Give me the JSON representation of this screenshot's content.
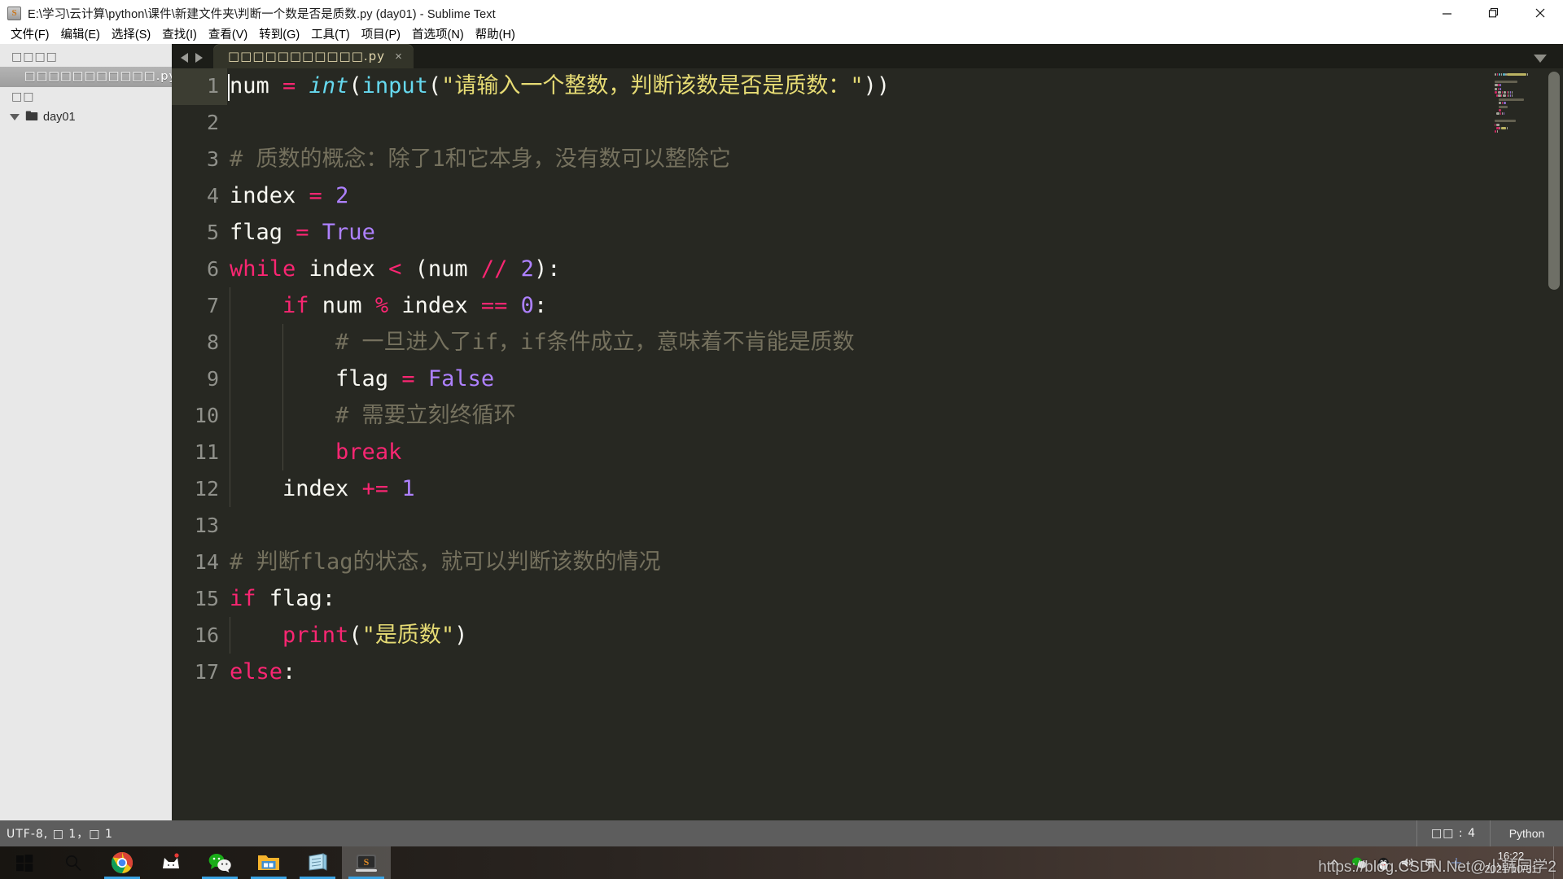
{
  "window": {
    "title": "E:\\学习\\云计算\\python\\课件\\新建文件夹\\判断一个数是否是质数.py (day01) - Sublime Text",
    "app_icon": "S",
    "minimize_icon": "minimize-icon",
    "restore_icon": "restore-icon",
    "close_icon": "close-icon"
  },
  "menubar": {
    "items": [
      {
        "label": "文件(F)"
      },
      {
        "label": "编辑(E)"
      },
      {
        "label": "选择(S)"
      },
      {
        "label": "查找(I)"
      },
      {
        "label": "查看(V)"
      },
      {
        "label": "转到(G)"
      },
      {
        "label": "工具(T)"
      },
      {
        "label": "项目(P)"
      },
      {
        "label": "首选项(N)"
      },
      {
        "label": "帮助(H)"
      }
    ]
  },
  "sidebar": {
    "open_files_header": "□□□□",
    "open_file": "□□□□□□□□□□□.py",
    "folders_header": "□□",
    "folder_name": "day01"
  },
  "tabbar": {
    "nav_prev_icon": "arrow-left-icon",
    "nav_next_icon": "arrow-right-icon",
    "tab_label": "□□□□□□□□□□□.py",
    "tab_close_icon": "×",
    "dropdown_icon": "chevron-down-icon"
  },
  "editor": {
    "language": "Python",
    "line_numbers": [
      1,
      2,
      3,
      4,
      5,
      6,
      7,
      8,
      9,
      10,
      11,
      12,
      13,
      14,
      15,
      16,
      17
    ],
    "code_lines": [
      {
        "n": 1,
        "indent": 0,
        "tokens": [
          {
            "t": "num ",
            "c": "wh"
          },
          {
            "t": "= ",
            "c": "k"
          },
          {
            "t": "int",
            "c": "fnI"
          },
          {
            "t": "(",
            "c": "wh"
          },
          {
            "t": "input",
            "c": "fn"
          },
          {
            "t": "(",
            "c": "wh"
          },
          {
            "t": "\"请输入一个整数，判断该数是否是质数：\"",
            "c": "str"
          },
          {
            "t": "))",
            "c": "wh"
          }
        ]
      },
      {
        "n": 2,
        "indent": 0,
        "tokens": []
      },
      {
        "n": 3,
        "indent": 0,
        "tokens": [
          {
            "t": "# 质数的概念：除了1和它本身，没有数可以整除它",
            "c": "com"
          }
        ]
      },
      {
        "n": 4,
        "indent": 0,
        "tokens": [
          {
            "t": "index ",
            "c": "wh"
          },
          {
            "t": "= ",
            "c": "k"
          },
          {
            "t": "2",
            "c": "num"
          }
        ]
      },
      {
        "n": 5,
        "indent": 0,
        "tokens": [
          {
            "t": "flag ",
            "c": "wh"
          },
          {
            "t": "= ",
            "c": "k"
          },
          {
            "t": "True",
            "c": "num"
          }
        ]
      },
      {
        "n": 6,
        "indent": 0,
        "tokens": [
          {
            "t": "while",
            "c": "k"
          },
          {
            "t": " index ",
            "c": "wh"
          },
          {
            "t": "<",
            "c": "k"
          },
          {
            "t": " (num ",
            "c": "wh"
          },
          {
            "t": "//",
            "c": "k"
          },
          {
            "t": " ",
            "c": "wh"
          },
          {
            "t": "2",
            "c": "num"
          },
          {
            "t": "):",
            "c": "wh"
          }
        ]
      },
      {
        "n": 7,
        "indent": 1,
        "tokens": [
          {
            "t": "if",
            "c": "k"
          },
          {
            "t": " num ",
            "c": "wh"
          },
          {
            "t": "%",
            "c": "k"
          },
          {
            "t": " index ",
            "c": "wh"
          },
          {
            "t": "==",
            "c": "k"
          },
          {
            "t": " ",
            "c": "wh"
          },
          {
            "t": "0",
            "c": "num"
          },
          {
            "t": ":",
            "c": "wh"
          }
        ]
      },
      {
        "n": 8,
        "indent": 2,
        "tokens": [
          {
            "t": "# 一旦进入了if，if条件成立，意味着不肯能是质数",
            "c": "com"
          }
        ]
      },
      {
        "n": 9,
        "indent": 2,
        "tokens": [
          {
            "t": "flag ",
            "c": "wh"
          },
          {
            "t": "= ",
            "c": "k"
          },
          {
            "t": "False",
            "c": "num"
          }
        ]
      },
      {
        "n": 10,
        "indent": 2,
        "tokens": [
          {
            "t": "# 需要立刻终循环",
            "c": "com"
          }
        ]
      },
      {
        "n": 11,
        "indent": 2,
        "tokens": [
          {
            "t": "break",
            "c": "k"
          }
        ]
      },
      {
        "n": 12,
        "indent": 1,
        "tokens": [
          {
            "t": "index ",
            "c": "wh"
          },
          {
            "t": "+=",
            "c": "k"
          },
          {
            "t": " ",
            "c": "wh"
          },
          {
            "t": "1",
            "c": "num"
          }
        ]
      },
      {
        "n": 13,
        "indent": 0,
        "tokens": []
      },
      {
        "n": 14,
        "indent": 0,
        "tokens": [
          {
            "t": "# 判断flag的状态，就可以判断该数的情况",
            "c": "com"
          }
        ]
      },
      {
        "n": 15,
        "indent": 0,
        "tokens": [
          {
            "t": "if",
            "c": "k"
          },
          {
            "t": " flag:",
            "c": "wh"
          }
        ]
      },
      {
        "n": 16,
        "indent": 1,
        "tokens": [
          {
            "t": "print",
            "c": "pl"
          },
          {
            "t": "(",
            "c": "wh"
          },
          {
            "t": "\"是质数\"",
            "c": "str"
          },
          {
            "t": ")",
            "c": "wh"
          }
        ]
      },
      {
        "n": 17,
        "indent": 0,
        "tokens": [
          {
            "t": "else",
            "c": "k"
          },
          {
            "t": ":",
            "c": "wh"
          }
        ]
      }
    ]
  },
  "statusbar": {
    "left": "UTF-8, □ 1，□ 1",
    "indent": "□□ : 4",
    "syntax": "Python"
  },
  "taskbar": {
    "start_icon": "windows-start-icon",
    "search_icon": "search-icon",
    "apps": [
      {
        "name": "chrome-icon",
        "running": true
      },
      {
        "name": "cat-app-icon",
        "running": false
      },
      {
        "name": "wechat-icon",
        "running": true
      },
      {
        "name": "file-explorer-icon",
        "running": true
      },
      {
        "name": "notepad-icon",
        "running": true
      },
      {
        "name": "sublime-text-icon",
        "running": true,
        "active": true
      }
    ],
    "tray": [
      {
        "name": "show-hidden-icons-chevron"
      },
      {
        "name": "wechat-tray-icon"
      },
      {
        "name": "qq-tray-icon"
      },
      {
        "name": "volume-icon"
      },
      {
        "name": "network-icon"
      },
      {
        "name": "ime-icon"
      }
    ],
    "time": "16:22",
    "date": "2021/10/31"
  },
  "watermark": {
    "text": "https://blog.CSDN.Net@小韩同学2"
  },
  "colors": {
    "editor_bg": "#272822",
    "keyword": "#f92672",
    "function": "#66d9ef",
    "number": "#ae81ff",
    "string": "#e6db74",
    "comment": "#75715e",
    "foreground": "#f8f8f2",
    "accent_taskbar": "#3aa3e3"
  }
}
